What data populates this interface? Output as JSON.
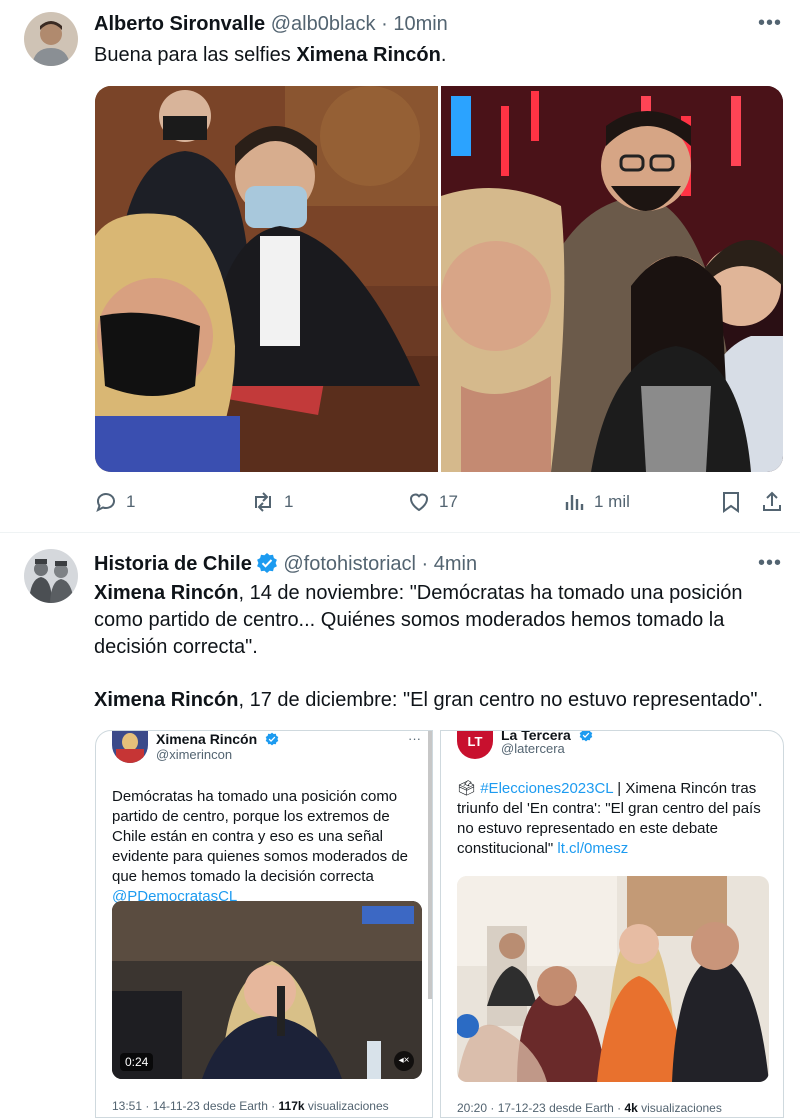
{
  "tweet1": {
    "author_name": "Alberto Sironvalle",
    "handle": "@alb0black",
    "separator": "·",
    "time": "10min",
    "text_prefix": "Buena para las selfies ",
    "text_bold": "Ximena Rincón",
    "text_suffix": ".",
    "replies": "1",
    "retweets": "1",
    "likes": "17",
    "views": "1 mil"
  },
  "tweet2": {
    "author_name": "Historia de Chile",
    "handle": "@fotohistoriacl",
    "separator": "·",
    "time": "4min",
    "p1_bold": "Ximena Rincón",
    "p1_rest": ", 14 de noviembre: \"Demócratas ha tomado una posición como partido de centro... Quiénes somos moderados hemos tomado la decisión correcta\".",
    "p2_bold": "Ximena Rincón",
    "p2_rest": ", 17 de diciembre: \"El gran centro no estuvo representado\".",
    "left_shot": {
      "name": "Ximena Rincón",
      "handle": "@ximerincon",
      "text": "Demócratas ha tomado una posición como partido de centro, porque los extremos de Chile están en contra y eso es una señal evidente para quienes somos moderados de que hemos tomado la decisión correcta ",
      "mention": "@PDemocratasCL",
      "video_time": "0:24",
      "footer_time": "13:51 · 14-11-23 desde Earth · ",
      "footer_views": "117k",
      "footer_views_label": " visualizaciones"
    },
    "right_shot": {
      "name": "La Tercera",
      "avatar_text": "LT",
      "handle": "@latercera",
      "hashtag": "#Elecciones2023CL",
      "text": " | Ximena Rincón tras triunfo del 'En contra': \"El gran centro del país no estuvo representado en este debate constitucional\" ",
      "link": "lt.cl/0mesz",
      "footer_time": "20:20 · 17-12-23 desde Earth · ",
      "footer_views": "4k",
      "footer_views_label": " visualizaciones"
    }
  },
  "icons": {
    "reply": "reply-icon",
    "retweet": "retweet-icon",
    "like": "heart-icon",
    "views": "views-icon",
    "bookmark": "bookmark-icon",
    "share": "share-icon",
    "more": "more-icon",
    "verified": "verified-badge-icon"
  },
  "colors": {
    "accent": "#1d9bf0",
    "text": "#0f1419",
    "muted": "#536471"
  }
}
